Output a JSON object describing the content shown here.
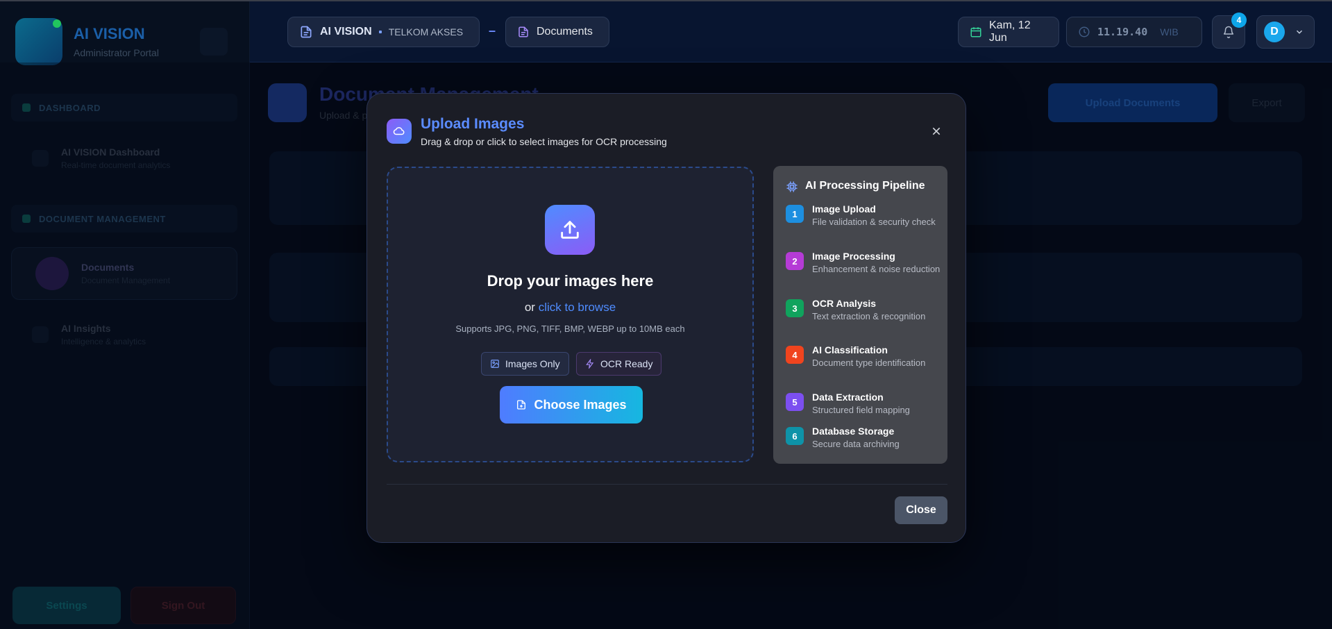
{
  "sidebar": {
    "brand_title": "AI VISION",
    "brand_subtitle": "Administrator Portal",
    "section_dashboard": "DASHBOARD",
    "dashboard_item": "AI VISION Dashboard",
    "dashboard_item_sub": "Real-time document analytics",
    "section_documents": "DOCUMENT MANAGEMENT",
    "documents_item": "Documents",
    "documents_item_sub": "Document Management",
    "insights_item": "AI Insights",
    "insights_item_sub": "Intelligence & analytics",
    "settings_label": "Settings",
    "logout_label": "Sign Out"
  },
  "topbar": {
    "app_name": "AI VISION",
    "org_name": "TELKOM AKSES",
    "separator": "–",
    "crumb_page": "Documents",
    "date": "Kam, 12 Jun",
    "time": "11.19.40",
    "timezone": "WIB",
    "notification_count": "4",
    "avatar_initial": "D"
  },
  "background": {
    "heading": "Document Management",
    "heading_sub": "Upload & process documents with AI",
    "upload_button": "Upload Documents",
    "export_button": "Export"
  },
  "modal": {
    "title": "Upload Images",
    "subtitle": "Drag & drop or click to select images for OCR processing",
    "drop_title": "Drop your images here",
    "or_text": "or",
    "browse_link": "click to browse",
    "supports": "Supports JPG, PNG, TIFF, BMP, WEBP up to 10MB each",
    "chip_images": "Images Only",
    "chip_ocr": "OCR Ready",
    "choose_button": "Choose Images",
    "close_button": "Close",
    "pipeline_title": "AI Processing Pipeline",
    "steps": [
      {
        "num": "1",
        "title": "Image Upload",
        "desc": "File validation & security check",
        "color": "#1d8fe0"
      },
      {
        "num": "2",
        "title": "Image Processing",
        "desc": "Enhancement & noise reduction",
        "color": "#b53bd6"
      },
      {
        "num": "3",
        "title": "OCR Analysis",
        "desc": "Text extraction & recognition",
        "color": "#10a35d"
      },
      {
        "num": "4",
        "title": "AI Classification",
        "desc": "Document type identification",
        "color": "#f0441e"
      },
      {
        "num": "5",
        "title": "Data Extraction",
        "desc": "Structured field mapping",
        "color": "#7c4ff0"
      },
      {
        "num": "6",
        "title": "Database Storage",
        "desc": "Secure data archiving",
        "color": "#0e93a8"
      }
    ]
  }
}
